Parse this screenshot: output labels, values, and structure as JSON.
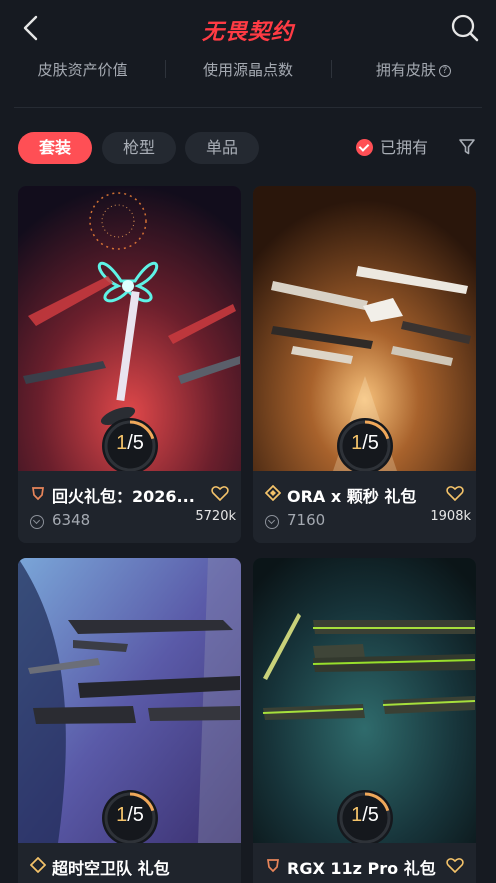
{
  "header": {
    "title": "无畏契约"
  },
  "stats": [
    "皮肤资产价值",
    "使用源晶点数",
    "拥有皮肤"
  ],
  "filters": {
    "tabs": [
      "套装",
      "枪型",
      "单品"
    ],
    "owned_label": "已拥有"
  },
  "colors": {
    "accent": "#ff4f55",
    "progress": "#f0a85a",
    "background": "#161a21",
    "card": "#1f242c"
  },
  "cards": [
    {
      "name": "回火礼包：2026...",
      "points": "6348",
      "likes": "5720k",
      "owned": "1",
      "total": "/5",
      "owned_fraction": 0.2
    },
    {
      "name": "ORA x 颗秒 礼包",
      "points": "7160",
      "likes": "1908k",
      "owned": "1",
      "total": "/5",
      "owned_fraction": 0.2
    },
    {
      "name": "超时空卫队 礼包",
      "points": "",
      "likes": "",
      "owned": "1",
      "total": "/5",
      "owned_fraction": 0.2
    },
    {
      "name": "RGX 11z Pro 礼包",
      "points": "",
      "likes": "",
      "owned": "1",
      "total": "/5",
      "owned_fraction": 0.2
    }
  ]
}
